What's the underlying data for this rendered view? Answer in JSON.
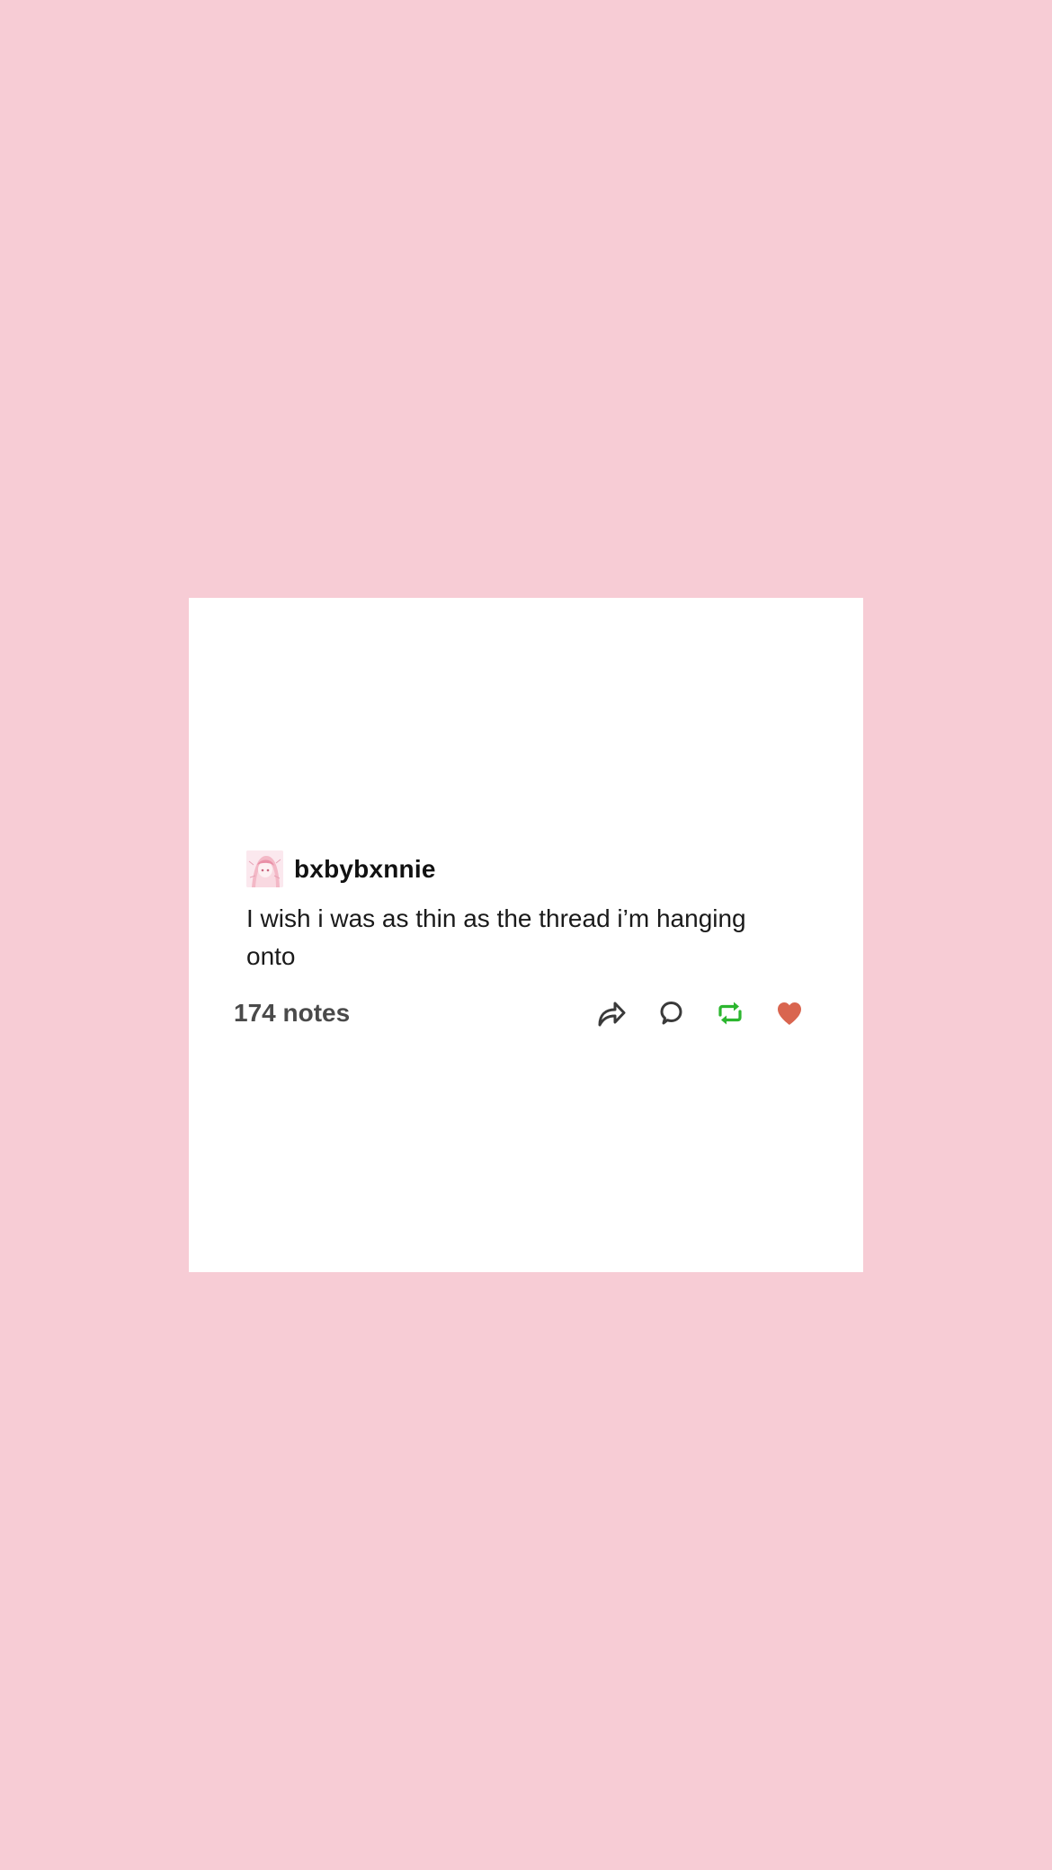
{
  "post": {
    "username": "bxbybxnnie",
    "text": "I wish i was as thin as the thread i’m hanging onto",
    "notes": "174 notes"
  },
  "actions": [
    {
      "name": "share-icon"
    },
    {
      "name": "reply-icon"
    },
    {
      "name": "reblog-icon"
    },
    {
      "name": "like-icon"
    }
  ],
  "colors": {
    "background": "#f7ccd5",
    "card": "#ffffff",
    "reblog": "#2cb62f",
    "like": "#d9654f",
    "icon": "#3a3a3a"
  }
}
